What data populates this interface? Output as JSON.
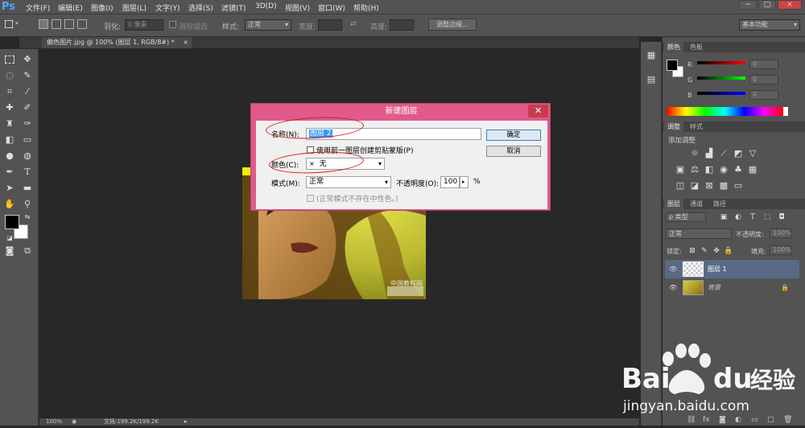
{
  "app": {
    "logo": "Ps"
  },
  "menu": [
    "文件(F)",
    "编辑(E)",
    "图像(I)",
    "图层(L)",
    "文字(Y)",
    "选择(S)",
    "滤镜(T)",
    "3D(D)",
    "视图(V)",
    "窗口(W)",
    "帮助(H)"
  ],
  "window_controls": [
    "−",
    "□",
    "×"
  ],
  "options": {
    "feather_label": "羽化:",
    "feather_value": "0 像素",
    "antialias_label": "消除锯齿",
    "style_label": "样式:",
    "style_value": "正常",
    "width_label": "宽度:",
    "height_label": "高度:",
    "refine_edge": "调整边缘...",
    "workspace": "基本功能"
  },
  "document": {
    "tab": "偏色图片.jpg @ 100% (图层 1, RGB/8#) *",
    "close": "×",
    "zoom": "100%",
    "status": "文档:199.2K/199.2K"
  },
  "color_panel": {
    "tabs": [
      "颜色",
      "色板"
    ],
    "channels": [
      {
        "label": "R",
        "value": "0"
      },
      {
        "label": "G",
        "value": "0"
      },
      {
        "label": "B",
        "value": "0"
      }
    ]
  },
  "adjust_panel": {
    "tabs": [
      "调整",
      "样式"
    ],
    "heading": "添加调整"
  },
  "layers_panel": {
    "tabs": [
      "图层",
      "通道",
      "路径"
    ],
    "filter": "ρ 类型",
    "mode": "正常",
    "opacity_label": "不透明度:",
    "opacity": "100%",
    "lock_label": "锁定:",
    "fill_label": "填充:",
    "fill": "100%",
    "layers": [
      {
        "name": "图层 1",
        "selected": true
      },
      {
        "name": "背景",
        "selected": false,
        "locked": true
      }
    ]
  },
  "dialog": {
    "title": "新建图层",
    "name_label": "名称(N):",
    "name_value": "图层 2",
    "checkbox_label": "使用前一图层创建剪贴蒙版(P)",
    "color_label": "颜色(C):",
    "color_value": "无",
    "color_x": "×",
    "mode_label": "模式(M):",
    "mode_value": "正常",
    "opacity_label": "不透明度(O):",
    "opacity_value": "100",
    "opacity_arrow": "▸",
    "percent": "%",
    "neutral_label": "(正常模式不存在中性色。)",
    "ok": "确定",
    "cancel": "取消"
  },
  "photo_watermark": "中国教程网",
  "watermark": {
    "brand": "Bai",
    "brand2": "du",
    "brand_cn": "经验",
    "url": "jingyan.baidu.com"
  }
}
